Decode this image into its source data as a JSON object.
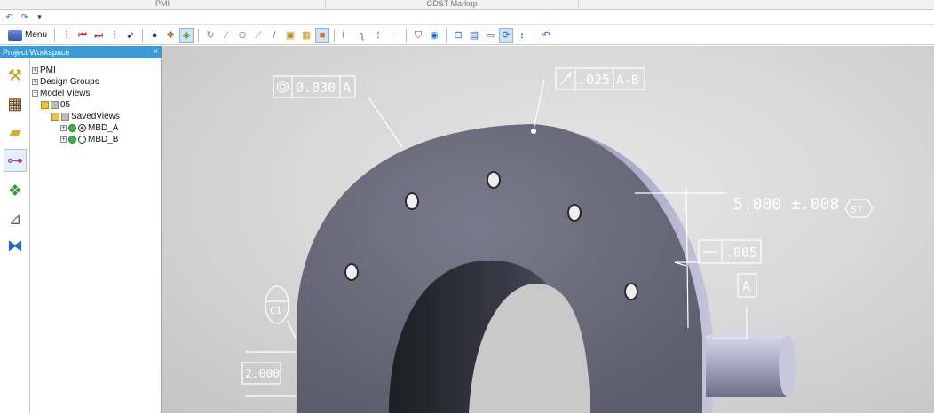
{
  "ribbon": {
    "tabs": [
      {
        "label": "",
        "width": 0
      },
      {
        "label": "PMI"
      },
      {
        "label": "GD&T Markup"
      },
      {
        "label": ""
      }
    ]
  },
  "toolbar": {
    "menu_label": "Menu"
  },
  "workspace": {
    "title": "Project Workspace",
    "close_glyph": "×",
    "tree": {
      "pmi": "PMI",
      "design_groups": "Design Groups",
      "model_views": "Model Views",
      "view_05": "05",
      "saved_views": "SavedViews",
      "mbd_a": "MBD_A",
      "mbd_b": "MBD_B"
    }
  },
  "pmi": {
    "fcf_top_left": {
      "value": "Ø.030",
      "datum": "A"
    },
    "fcf_runout": {
      "value": ".025",
      "datum": "A-B"
    },
    "dimension": {
      "value": "5.000 ±.008",
      "tag": "ST"
    },
    "flatness": {
      "value": ".005"
    },
    "datum_a": "A",
    "callout_c1": "C1",
    "basic_dim": "2.000"
  },
  "colors": {
    "panel_header": "#3c9ad6",
    "part_face": "#6f6f80",
    "part_edge": "#a8a8c4",
    "bore": "#2a2a32",
    "pmi": "#ffffff"
  }
}
